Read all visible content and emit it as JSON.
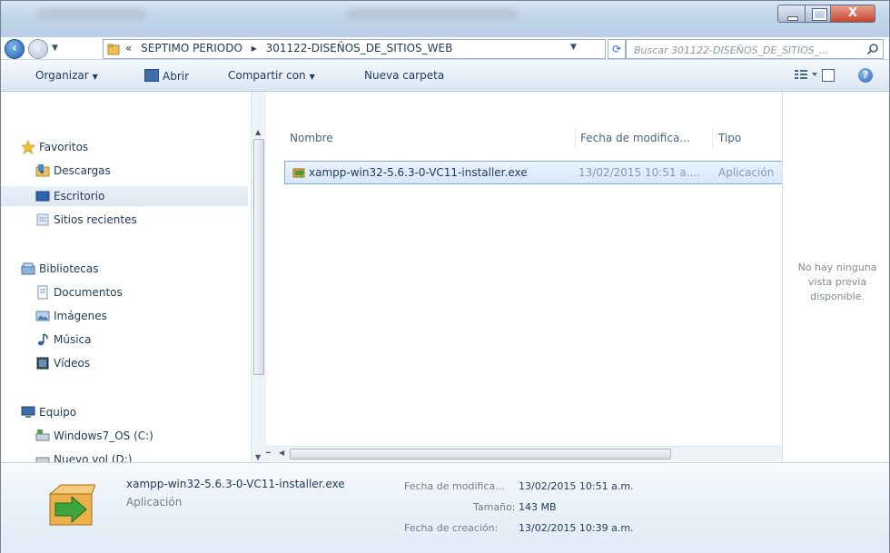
{
  "window": {
    "close_label": "X"
  },
  "address_bar": {
    "crumbs": [
      "«",
      "SEPTIMO PERIODO",
      "▸",
      "301122-DISEÑOS_DE_SITIOS_WEB"
    ],
    "search_placeholder": "Buscar 301122-DISEÑOS_DE_SITIOS_..."
  },
  "toolbar": {
    "organize_label": "Organizar",
    "open_label": "Abrir",
    "share_label": "Compartir con",
    "new_folder_label": "Nueva carpeta"
  },
  "nav_pane": {
    "items": [
      {
        "label": "Favoritos",
        "icon": "star-icon"
      },
      {
        "label": "Descargas",
        "icon": "downloads-folder-icon"
      },
      {
        "label": "Escritorio",
        "icon": "desktop-icon",
        "selected": true
      },
      {
        "label": "Sitios recientes",
        "icon": "recent-places-icon"
      },
      {
        "label": "Bibliotecas",
        "icon": "libraries-icon"
      },
      {
        "label": "Documentos",
        "icon": "documents-icon"
      },
      {
        "label": "Imágenes",
        "icon": "pictures-icon"
      },
      {
        "label": "Música",
        "icon": "music-icon"
      },
      {
        "label": "Vídeos",
        "icon": "videos-icon"
      },
      {
        "label": "Equipo",
        "icon": "computer-icon"
      },
      {
        "label": "Windows7_OS (C:)",
        "icon": "drive-icon"
      },
      {
        "label": "Nuevo vol (D:)",
        "icon": "drive-icon"
      }
    ]
  },
  "file_list": {
    "columns": {
      "name": "Nombre",
      "date": "Fecha de modifica...",
      "type": "Tipo"
    },
    "rows": [
      {
        "name": "xampp-win32-5.6.3-0-VC11-installer.exe",
        "date": "13/02/2015 10:51 a....",
        "type": "Aplicación"
      }
    ]
  },
  "preview_pane": {
    "message": "No hay ninguna vista previa disponible."
  },
  "details_pane": {
    "file_name": "xampp-win32-5.6.3-0-VC11-installer.exe",
    "file_type": "Aplicación",
    "modified_label": "Fecha de modifica...",
    "modified_value": "13/02/2015 10:51 a.m.",
    "size_label": "Tamaño:",
    "size_value": "143 MB",
    "created_label": "Fecha de creación:",
    "created_value": "13/02/2015 10:39 a.m."
  },
  "colors": {
    "selection_fill": "#d6e8fb",
    "selection_border": "#84acdd",
    "text": "#1e395b",
    "close_button": "#c8462f"
  }
}
